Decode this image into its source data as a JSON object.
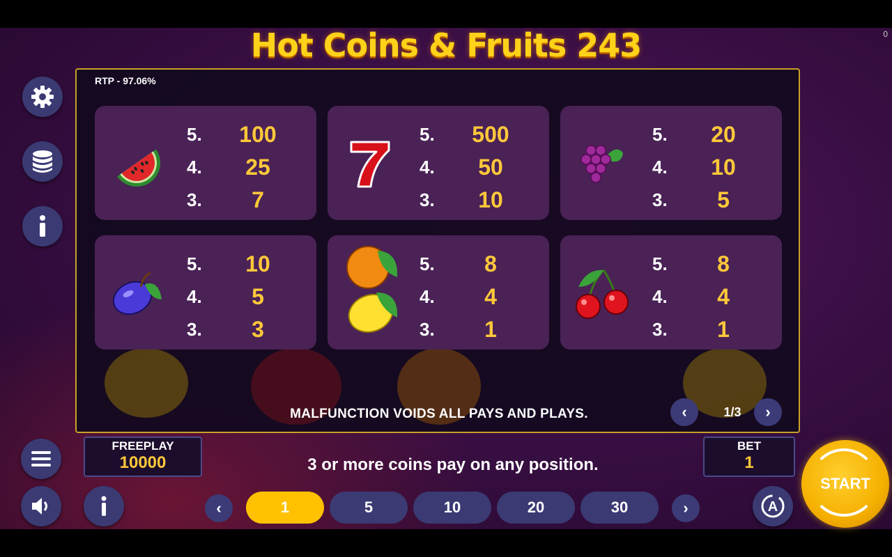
{
  "title": "Hot Coins & Fruits 243",
  "corner_counter": "0",
  "rtp": "RTP - 97.06%",
  "paytable": [
    {
      "symbol": "watermelon-icon",
      "pays": [
        {
          "n": "5.",
          "v": "100"
        },
        {
          "n": "4.",
          "v": "25"
        },
        {
          "n": "3.",
          "v": "7"
        }
      ]
    },
    {
      "symbol": "seven-icon",
      "pays": [
        {
          "n": "5.",
          "v": "500"
        },
        {
          "n": "4.",
          "v": "50"
        },
        {
          "n": "3.",
          "v": "10"
        }
      ]
    },
    {
      "symbol": "grapes-icon",
      "pays": [
        {
          "n": "5.",
          "v": "20"
        },
        {
          "n": "4.",
          "v": "10"
        },
        {
          "n": "3.",
          "v": "5"
        }
      ]
    },
    {
      "symbol": "plum-icon",
      "pays": [
        {
          "n": "5.",
          "v": "10"
        },
        {
          "n": "4.",
          "v": "5"
        },
        {
          "n": "3.",
          "v": "3"
        }
      ]
    },
    {
      "symbol": "orange-lemon-icon",
      "pays": [
        {
          "n": "5.",
          "v": "8"
        },
        {
          "n": "4.",
          "v": "4"
        },
        {
          "n": "3.",
          "v": "1"
        }
      ]
    },
    {
      "symbol": "cherry-icon",
      "pays": [
        {
          "n": "5.",
          "v": "8"
        },
        {
          "n": "4.",
          "v": "4"
        },
        {
          "n": "3.",
          "v": "1"
        }
      ]
    }
  ],
  "malfunction": "MALFUNCTION VOIDS ALL PAYS AND PLAYS.",
  "pagination": {
    "text": "1/3",
    "prev": "‹",
    "next": "›"
  },
  "freeplay": {
    "label": "FREEPLAY",
    "value": "10000"
  },
  "bet": {
    "label": "BET",
    "value": "1"
  },
  "info_message": "3 or more coins pay on any position.",
  "bet_options": [
    "1",
    "5",
    "10",
    "20",
    "30"
  ],
  "selected_bet": "1",
  "start_label": "START",
  "colors": {
    "accent": "#ffc100",
    "panel_border": "#c9a227",
    "card": "#4a2256",
    "button": "#3b3a73"
  }
}
